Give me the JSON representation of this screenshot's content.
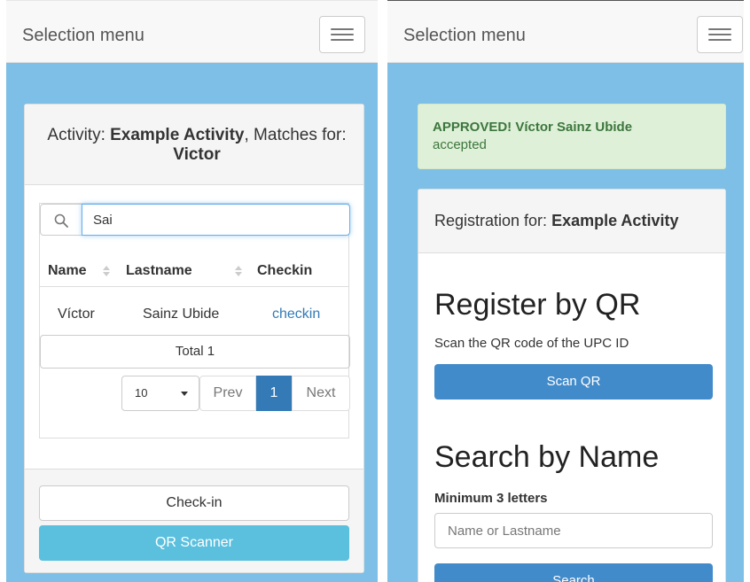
{
  "left": {
    "navbar": {
      "brand": "Selection menu"
    },
    "card": {
      "title_prefix": "Activity: ",
      "title_activity": "Example Activity",
      "title_mid": ", Matches for: ",
      "title_name": "Victor"
    },
    "search": {
      "value": "Sai"
    },
    "table": {
      "columns": [
        "Name",
        "Lastname",
        "Checkin"
      ],
      "rows": [
        {
          "name": "Víctor",
          "lastname": "Sainz Ubide",
          "checkin": "checkin"
        }
      ]
    },
    "total": "Total 1",
    "pagination": {
      "page_size": "10",
      "prev": "Prev",
      "current": "1",
      "next": "Next"
    },
    "footer": {
      "checkin_button": "Check-in",
      "qr_button": "QR Scanner"
    }
  },
  "right": {
    "navbar": {
      "brand": "Selection menu"
    },
    "alert": {
      "title": "APPROVED! Víctor Sainz Ubide",
      "message": "accepted"
    },
    "card": {
      "title_prefix": "Registration for: ",
      "title_activity": "Example Activity",
      "qr_heading": "Register by QR",
      "qr_text": "Scan the QR code of the UPC ID",
      "scan_button": "Scan QR",
      "search_heading": "Search by Name",
      "search_hint": "Minimum 3 letters",
      "search_placeholder": "Name or Lastname",
      "search_button": "Search"
    }
  },
  "colors": {
    "background": "#7dbfe6",
    "primary": "#428bca",
    "info": "#5bc0de",
    "link": "#337ab7",
    "success_bg": "#dff0d8",
    "success_text": "#3c763d"
  }
}
